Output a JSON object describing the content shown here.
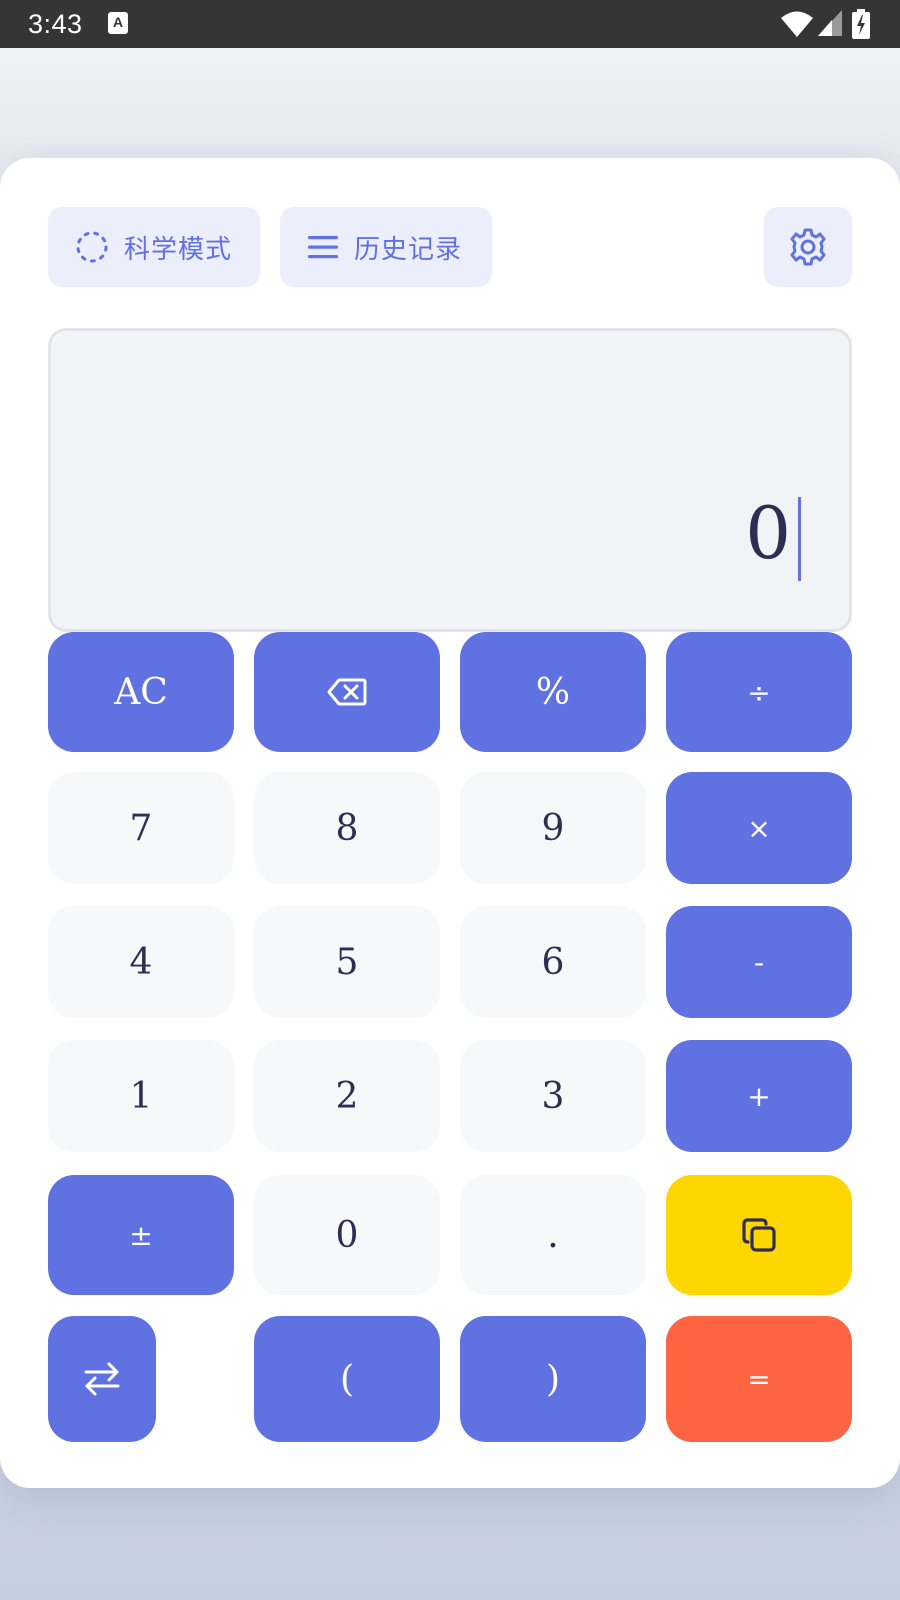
{
  "status_bar": {
    "time": "3:43",
    "notification_glyph": "A"
  },
  "toolbar": {
    "scientific_mode_label": "科学模式",
    "history_label": "历史记录",
    "settings_icon": "gear-icon"
  },
  "display": {
    "value": "0"
  },
  "keypad": {
    "ac": "AC",
    "backspace_icon": "backspace-icon",
    "percent": "%",
    "divide": "÷",
    "seven": "7",
    "eight": "8",
    "nine": "9",
    "multiply": "×",
    "four": "4",
    "five": "5",
    "six": "6",
    "minus": "-",
    "one": "1",
    "two": "2",
    "three": "3",
    "plus": "+",
    "plus_minus": "±",
    "zero": "0",
    "dot": ".",
    "copy_icon": "copy-icon",
    "swap_icon": "swap-arrows-icon",
    "open_paren": "(",
    "close_paren": ")",
    "equals": "="
  },
  "colors": {
    "accent": "#6072e1",
    "number_key_bg": "#f7f8f9",
    "copy_key": "#ffd600",
    "equals_key": "#fc6442",
    "text_dark": "#2e2e54"
  }
}
